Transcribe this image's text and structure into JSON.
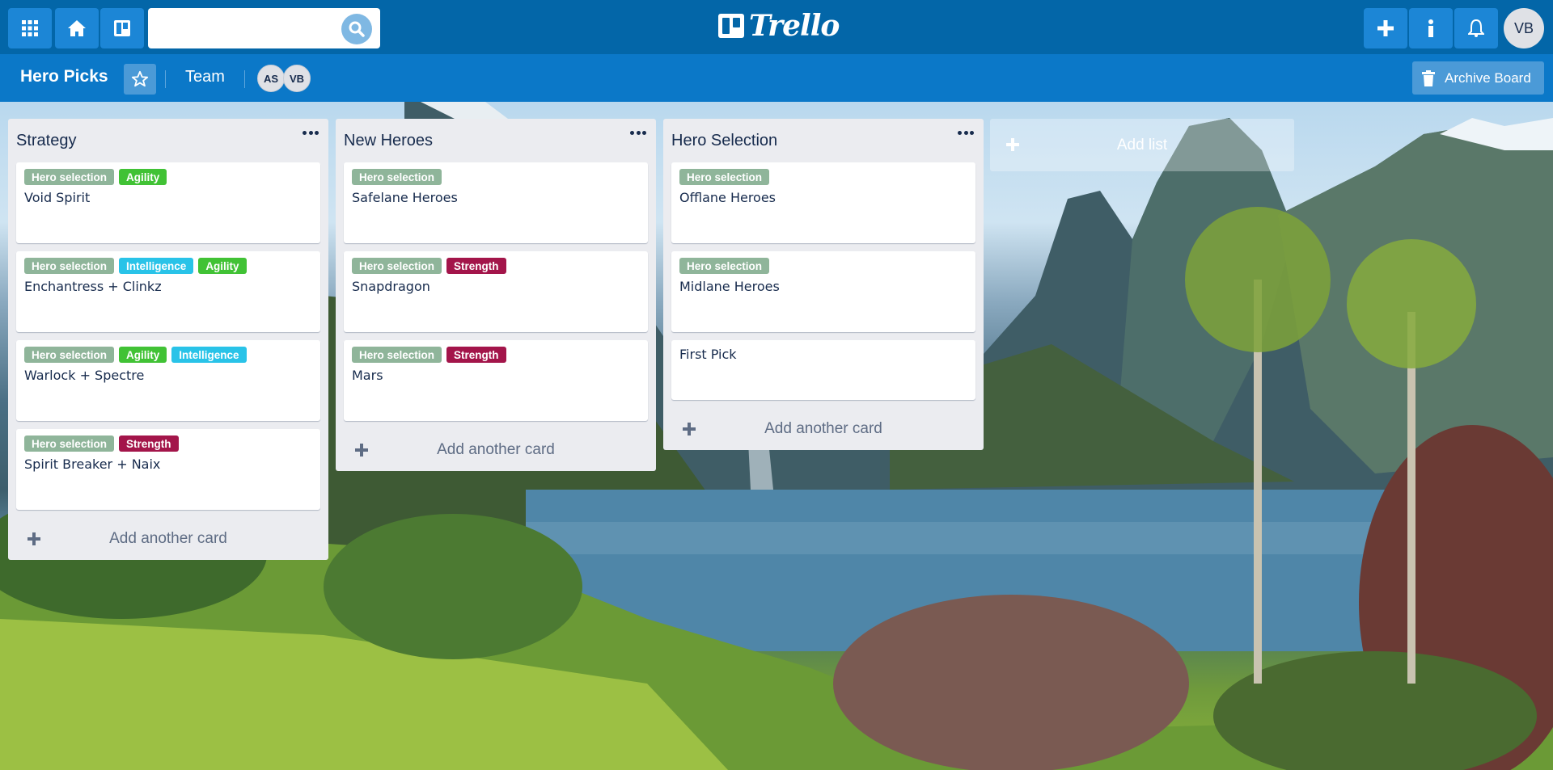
{
  "colors": {
    "topbar": "#0366a8",
    "boardbar": "#0b78c8",
    "button": "#1c86d6",
    "label_hero_selection": "#8fb59a",
    "label_agility": "#41c235",
    "label_intelligence": "#29c3e8",
    "label_strength": "#a3154a"
  },
  "topbar": {
    "apps_icon": "grid-icon",
    "home_icon": "home-icon",
    "boards_icon": "boards-icon",
    "search_placeholder": "",
    "search_value": "",
    "logo_text": "Trello",
    "create_icon": "plus-icon",
    "info_icon": "info-icon",
    "notifications_icon": "bell-icon",
    "avatar": "VB"
  },
  "board": {
    "title": "Hero Picks",
    "team": "Team",
    "members": [
      "AS",
      "VB"
    ],
    "archive_label": "Archive Board"
  },
  "lists": [
    {
      "title": "Strategy",
      "cards": [
        {
          "title": "Void Spirit",
          "labels": [
            "Hero selection",
            "Agility"
          ]
        },
        {
          "title": "Enchantress + Clinkz",
          "labels": [
            "Hero selection",
            "Intelligence",
            "Agility"
          ]
        },
        {
          "title": "Warlock + Spectre",
          "labels": [
            "Hero selection",
            "Agility",
            "Intelligence"
          ]
        },
        {
          "title": "Spirit Breaker + Naix",
          "labels": [
            "Hero selection",
            "Strength"
          ]
        }
      ],
      "add_card": "Add another card"
    },
    {
      "title": "New Heroes",
      "cards": [
        {
          "title": "Safelane Heroes",
          "labels": [
            "Hero selection"
          ]
        },
        {
          "title": "Snapdragon",
          "labels": [
            "Hero selection",
            "Strength"
          ]
        },
        {
          "title": "Mars",
          "labels": [
            "Hero selection",
            "Strength"
          ]
        }
      ],
      "add_card": "Add another card"
    },
    {
      "title": "Hero Selection",
      "cards": [
        {
          "title": "Offlane Heroes",
          "labels": [
            "Hero selection"
          ]
        },
        {
          "title": "Midlane Heroes",
          "labels": [
            "Hero selection"
          ]
        },
        {
          "title": "First Pick",
          "labels": []
        }
      ],
      "add_card": "Add another card"
    }
  ],
  "add_list": "Add list"
}
